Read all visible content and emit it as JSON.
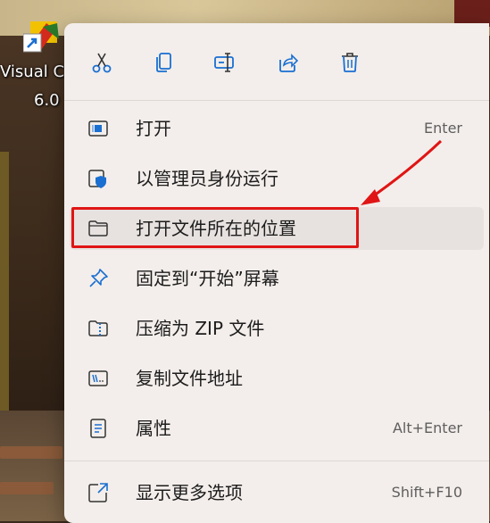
{
  "desktop": {
    "icon_name_line1": "Visual C",
    "icon_name_line2": "6.0",
    "icon": "visual-c-app-icon"
  },
  "toolbar": [
    {
      "name": "cut-button",
      "icon": "scissors-icon"
    },
    {
      "name": "copy-button",
      "icon": "copy-icon"
    },
    {
      "name": "rename-button",
      "icon": "rename-icon"
    },
    {
      "name": "share-button",
      "icon": "share-icon"
    },
    {
      "name": "delete-button",
      "icon": "trash-icon"
    }
  ],
  "menu": {
    "items": [
      {
        "label": "打开",
        "shortcut": "Enter",
        "icon": "open-window-icon"
      },
      {
        "label": "以管理员身份运行",
        "shortcut": "",
        "icon": "admin-shield-icon"
      },
      {
        "label": "打开文件所在的位置",
        "shortcut": "",
        "icon": "folder-icon"
      },
      {
        "label": "固定到“开始”屏幕",
        "shortcut": "",
        "icon": "pin-icon"
      },
      {
        "label": "压缩为 ZIP 文件",
        "shortcut": "",
        "icon": "zip-icon"
      },
      {
        "label": "复制文件地址",
        "shortcut": "",
        "icon": "copy-path-icon"
      },
      {
        "label": "属性",
        "shortcut": "Alt+Enter",
        "icon": "properties-icon"
      },
      {
        "label": "显示更多选项",
        "shortcut": "Shift+F10",
        "icon": "more-options-icon"
      }
    ]
  },
  "annotation": {
    "highlight_color": "#e01515",
    "highlighted_item": "打开文件所在的位置"
  },
  "colors": {
    "accent": "#1a6fd1",
    "menu_bg": "#f3eeeb"
  }
}
